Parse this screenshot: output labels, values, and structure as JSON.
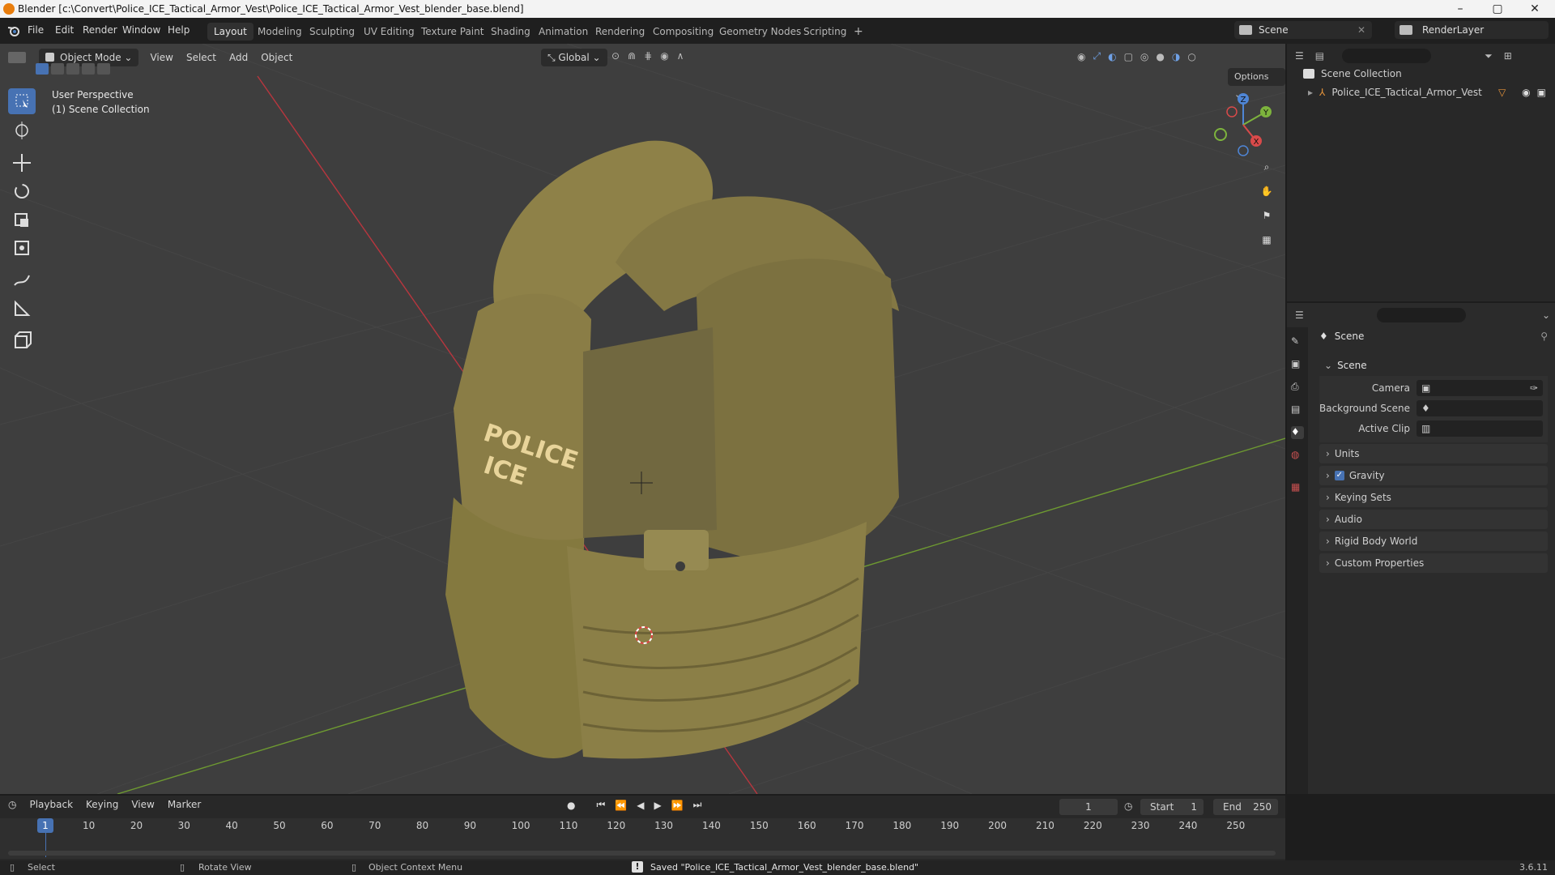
{
  "window": {
    "title": "Blender [c:\\Convert\\Police_ICE_Tactical_Armor_Vest\\Police_ICE_Tactical_Armor_Vest_blender_base.blend]",
    "controls": [
      "–",
      "▢",
      "✕"
    ]
  },
  "menu": [
    "File",
    "Edit",
    "Render",
    "Window",
    "Help"
  ],
  "workspaces": [
    {
      "label": "Layout",
      "active": true
    },
    {
      "label": "Modeling"
    },
    {
      "label": "Sculpting"
    },
    {
      "label": "UV Editing"
    },
    {
      "label": "Texture Paint"
    },
    {
      "label": "Shading"
    },
    {
      "label": "Animation"
    },
    {
      "label": "Rendering"
    },
    {
      "label": "Compositing"
    },
    {
      "label": "Geometry Nodes"
    },
    {
      "label": "Scripting"
    }
  ],
  "add_workspace": "+",
  "scene_selector": {
    "label": "Scene"
  },
  "render_layer": {
    "label": "RenderLayer"
  },
  "viewport": {
    "mode": "Object Mode",
    "menus": [
      "View",
      "Select",
      "Add",
      "Object"
    ],
    "transform_orientation": "Global",
    "options_label": "Options",
    "overlay_title": "User Perspective",
    "overlay_subtitle": "(1) Scene Collection",
    "gizmo_axes": {
      "z": "Z",
      "y": "Y",
      "x": "X"
    },
    "text_on_model": [
      "POLICE",
      "ICE"
    ],
    "colors": {
      "bg": "#3e3e3e",
      "x_axis": "#b8363e",
      "y_axis": "#6e9a31",
      "vest": "#8c7f45"
    }
  },
  "toolbar_icons": [
    "select-box-icon",
    "cursor-icon",
    "move-icon",
    "rotate-icon",
    "scale-icon",
    "transform-icon",
    "annotate-icon",
    "measure-icon",
    "add-cube-icon"
  ],
  "outliner": {
    "root": "Scene Collection",
    "items": [
      {
        "label": "Police_ICE_Tactical_Armor_Vest"
      }
    ]
  },
  "properties": {
    "header": "Scene",
    "panel_title": "Scene",
    "fields": [
      {
        "label": "Camera",
        "value": ""
      },
      {
        "label": "Background Scene",
        "value": ""
      },
      {
        "label": "Active Clip",
        "value": ""
      }
    ],
    "sections": [
      {
        "label": "Units",
        "checkbox": false
      },
      {
        "label": "Gravity",
        "checkbox": true
      },
      {
        "label": "Keying Sets",
        "checkbox": false
      },
      {
        "label": "Audio",
        "checkbox": false
      },
      {
        "label": "Rigid Body World",
        "checkbox": false
      },
      {
        "label": "Custom Properties",
        "checkbox": false
      }
    ]
  },
  "timeline": {
    "menus": [
      "Playback",
      "Keying",
      "View",
      "Marker"
    ],
    "current_frame": "1",
    "start_label": "Start",
    "start_value": "1",
    "end_label": "End",
    "end_value": "250",
    "ticks": [
      "1",
      "10",
      "20",
      "30",
      "40",
      "50",
      "60",
      "70",
      "80",
      "90",
      "100",
      "110",
      "120",
      "130",
      "140",
      "150",
      "160",
      "170",
      "180",
      "190",
      "200",
      "210",
      "220",
      "230",
      "240",
      "250"
    ]
  },
  "statusbar": {
    "select": "Select",
    "rotate": "Rotate View",
    "context": "Object Context Menu",
    "message": "Saved \"Police_ICE_Tactical_Armor_Vest_blender_base.blend\"",
    "version": "3.6.11"
  }
}
